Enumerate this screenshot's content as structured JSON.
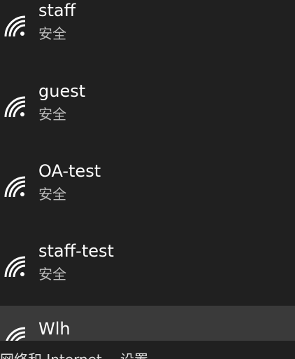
{
  "networks": [
    {
      "ssid": "staff",
      "status": "安全",
      "icon": "wifi-icon"
    },
    {
      "ssid": "guest",
      "status": "安全",
      "icon": "wifi-icon"
    },
    {
      "ssid": "OA-test",
      "status": "安全",
      "icon": "wifi-icon"
    },
    {
      "ssid": "staff-test",
      "status": "安全",
      "icon": "wifi-icon"
    },
    {
      "ssid": "Wlh",
      "status": "",
      "icon": "wifi-icon"
    }
  ],
  "footer": {
    "left_text": "网络和 Internet",
    "right_text": "设置"
  },
  "colors": {
    "background": "#202020",
    "hover_row": "#3a3a3a",
    "text": "#ffffff",
    "secondary_text": "#bdbdbd"
  }
}
